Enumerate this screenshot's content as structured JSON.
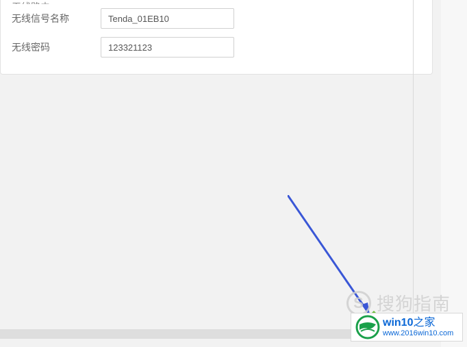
{
  "card": {
    "title": "无线路由",
    "fields": {
      "ssid": {
        "label": "无线信号名称",
        "value": "Tenda_01EB10"
      },
      "password": {
        "label": "无线密码",
        "value": "123321123"
      }
    }
  },
  "watermarks": {
    "sogou": "搜狗指南",
    "win10_brand": "win10",
    "win10_suffix": "之家",
    "win10_url": "www.2016win10.com"
  }
}
